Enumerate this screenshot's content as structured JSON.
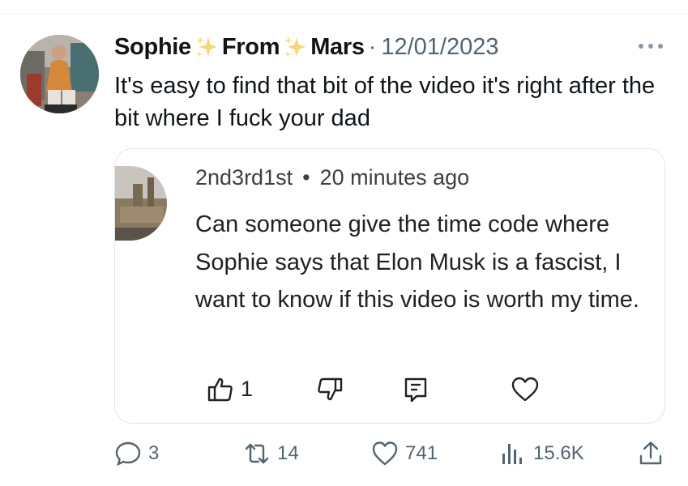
{
  "tweet": {
    "author_name_part1": "Sophie",
    "author_name_part2": "From",
    "author_name_part3": "Mars",
    "separator": "·",
    "date": "12/01/2023",
    "text": "It's easy to find that bit of the video it's right after the bit where I fuck your dad",
    "icons": {
      "sparkle": "sparkles-emoji",
      "more": "more-horizontal-icon"
    }
  },
  "quoted_comment": {
    "username": "2nd3rd1st",
    "separator": "•",
    "time_ago": "20 minutes ago",
    "text": "Can someone give the time code where Sophie says that Elon Musk is a fascist, I want to know if this video is worth my time.",
    "like_count": "1",
    "icons": [
      "thumbs-up-icon",
      "thumbs-down-icon",
      "reply-icon",
      "heart-icon"
    ]
  },
  "actions": {
    "replies": "3",
    "retweets": "14",
    "likes": "741",
    "views": "15.6K"
  },
  "colors": {
    "text": "#0f1419",
    "muted": "#536471",
    "sparkle": "#f7d774",
    "border": "#e1e6ea"
  }
}
